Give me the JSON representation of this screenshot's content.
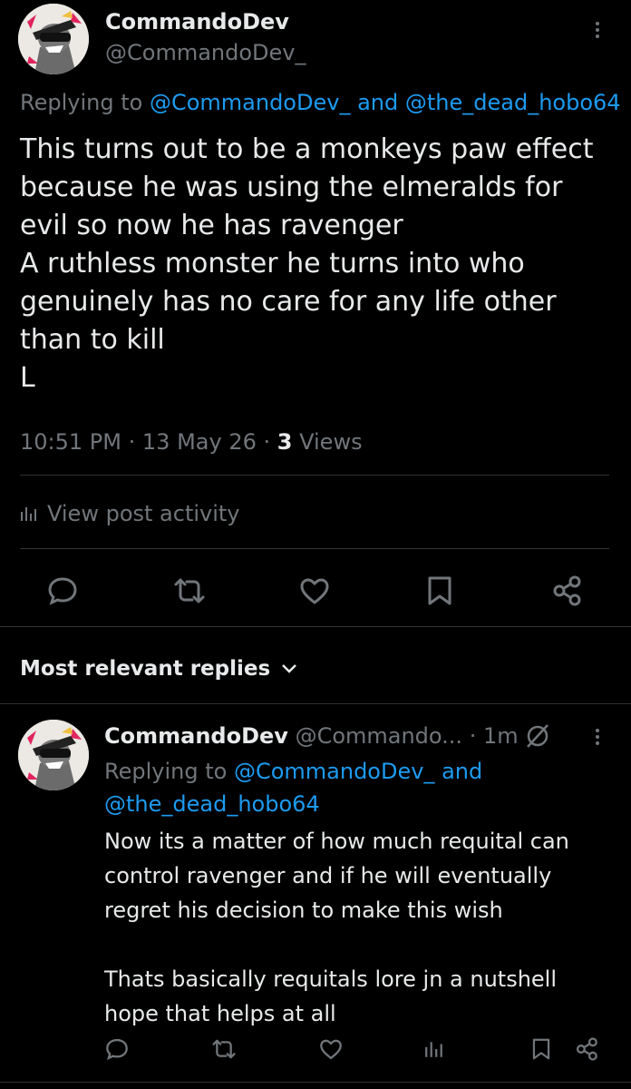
{
  "main_post": {
    "display_name": "CommandoDev",
    "handle": "@CommandoDev_",
    "replying_prefix": "Replying to",
    "reply_to_1": "@CommandoDev_",
    "reply_and": "and",
    "reply_to_2": "@the_dead_hobo64",
    "text_lines": [
      "This turns out to be a monkeys paw effect",
      "because he was using the elmeralds for",
      "evil so now he has ravenger",
      "A ruthless monster he turns into who",
      "genuinely has no care for any life other",
      "than to kill",
      "L"
    ],
    "time": "10:51 PM",
    "dot": "·",
    "date": "13 May 26",
    "views_count": "3",
    "views_label": "Views",
    "activity_label": "View post activity",
    "actions": [
      "reply-icon",
      "repost-icon",
      "like-icon",
      "bookmark-icon",
      "share-icon"
    ]
  },
  "replies_section": {
    "sort_label": "Most relevant replies"
  },
  "reply": {
    "display_name": "CommandoDev",
    "handle": "@Commando...",
    "dot": "·",
    "time": "1m",
    "replying_prefix": "Replying to",
    "reply_to_1": "@CommandoDev_",
    "reply_and": "and",
    "reply_to_2": "@the_dead_hobo64",
    "text_lines_1": [
      "Now its a matter of how much requital can",
      "control ravenger and if he will eventually",
      "regret his decision to make this wish"
    ],
    "text_lines_2": [
      "Thats basically requitals lore jn a nutshell",
      "hope that helps at all"
    ],
    "actions": [
      "reply-icon",
      "repost-icon",
      "like-icon",
      "views-icon",
      "bookmark-icon",
      "share-icon"
    ]
  },
  "colors": {
    "background": "#000000",
    "text": "#e7e9ea",
    "muted": "#71767b",
    "link": "#1d9bf0",
    "divider": "#2f3336"
  }
}
